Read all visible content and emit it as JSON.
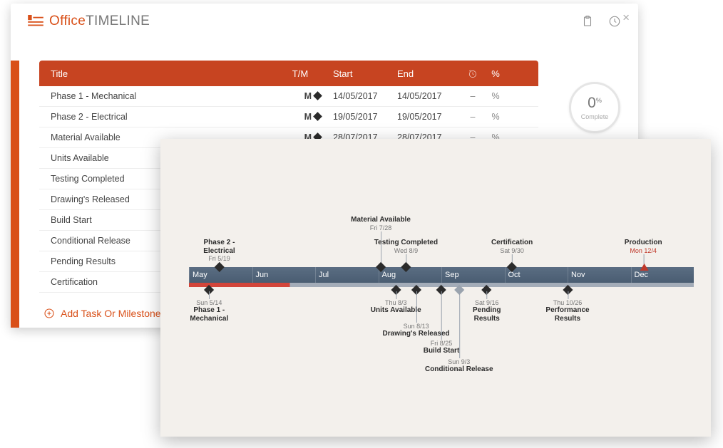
{
  "brand": {
    "part1": "Office",
    "part2": "TIMELINE"
  },
  "columns": {
    "title": "Title",
    "tm": "T/M",
    "start": "Start",
    "end": "End"
  },
  "rows": [
    {
      "title": "Phase 1 - Mechanical",
      "tm": "M",
      "start": "14/05/2017",
      "end": "14/05/2017",
      "dur": "–",
      "pct": "%"
    },
    {
      "title": "Phase 2 - Electrical",
      "tm": "M",
      "start": "19/05/2017",
      "end": "19/05/2017",
      "dur": "–",
      "pct": "%"
    },
    {
      "title": "Material Available",
      "tm": "M",
      "start": "28/07/2017",
      "end": "28/07/2017",
      "dur": "–",
      "pct": "%"
    },
    {
      "title": "Units Available"
    },
    {
      "title": "Testing Completed"
    },
    {
      "title": "Drawing's Released"
    },
    {
      "title": "Build Start"
    },
    {
      "title": "Conditional Release"
    },
    {
      "title": "Pending Results"
    },
    {
      "title": "Certification"
    }
  ],
  "add_label": "Add Task Or Milestone",
  "progress": {
    "value": "0",
    "unit": "%",
    "label": "Complete"
  },
  "chart_data": {
    "type": "timeline",
    "months": [
      "May",
      "Jun",
      "Jul",
      "Aug",
      "Sep",
      "Oct",
      "Nov",
      "Dec"
    ],
    "milestones_top": [
      {
        "name": "Phase 2 -\nElectrical",
        "date": "Fri 5/19",
        "pos": 6
      },
      {
        "name": "Material Available",
        "date": "Fri 7/28",
        "pos": 38,
        "tall": true
      },
      {
        "name": "Testing Completed",
        "date": "Wed 8/9",
        "pos": 43
      },
      {
        "name": "Certification",
        "date": "Sat 9/30",
        "pos": 64
      },
      {
        "name": "Production",
        "date": "Mon 12/4",
        "pos": 90,
        "red": true
      }
    ],
    "milestones_bot": [
      {
        "name": "Phase 1 -\nMechanical",
        "date": "Sun 5/14",
        "pos": 4,
        "depth": 0
      },
      {
        "name": "Units Available",
        "date": "Thu 8/3",
        "pos": 41,
        "depth": 0
      },
      {
        "name": "Drawing's Released",
        "date": "Sun 8/13",
        "pos": 45,
        "depth": 1
      },
      {
        "name": "Build Start",
        "date": "Fri 8/25",
        "pos": 50,
        "depth": 2
      },
      {
        "name": "Conditional Release",
        "date": "Sun 9/3",
        "pos": 53.5,
        "depth": 3,
        "gray": true
      },
      {
        "name": "Pending\nResults",
        "date": "Sat 9/16",
        "pos": 59,
        "depth": 0
      },
      {
        "name": "Performance\nResults",
        "date": "Thu 10/26",
        "pos": 75,
        "depth": 0
      }
    ]
  }
}
